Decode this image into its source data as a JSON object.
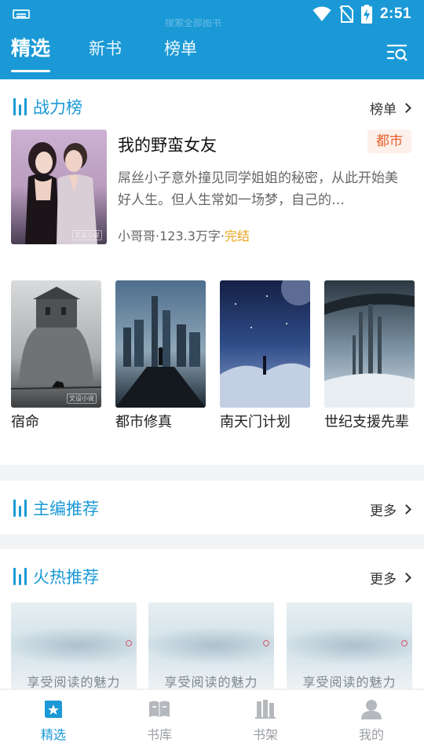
{
  "status_bar": {
    "time": "2:51",
    "overlay_text": "搜索全部图书"
  },
  "header": {
    "tabs": [
      {
        "label": "精选",
        "active": true
      },
      {
        "label": "新书",
        "active": false
      },
      {
        "label": "榜单",
        "active": false
      }
    ]
  },
  "ranking": {
    "title": "战力榜",
    "link_label": "榜单",
    "featured": {
      "title": "我的野蛮女友",
      "genre": "都市",
      "description": "屌丝小子意外撞见同学姐姐的秘密，从此开始美好人生。但人生常如一场梦，自己的…",
      "author": "小哥哥",
      "word_count": "123.3万字",
      "status": "完结",
      "separator": "·"
    },
    "books": [
      {
        "title": "宿命"
      },
      {
        "title": "都市修真"
      },
      {
        "title": "南天门计划"
      },
      {
        "title": "世纪支援先辈"
      }
    ],
    "cover_watermark": "文设小说"
  },
  "editor_picks": {
    "title": "主编推荐",
    "more_label": "更多"
  },
  "hot": {
    "title": "火热推荐",
    "more_label": "更多",
    "tiles": [
      {
        "caption": "享受阅读的魅力"
      },
      {
        "caption": "享受阅读的魅力"
      },
      {
        "caption": "享受阅读的魅力"
      }
    ]
  },
  "bottom_nav": {
    "items": [
      {
        "label": "精选",
        "icon": "star-book-icon",
        "active": true
      },
      {
        "label": "书库",
        "icon": "open-book-icon",
        "active": false
      },
      {
        "label": "书架",
        "icon": "bookshelf-icon",
        "active": false
      },
      {
        "label": "我的",
        "icon": "person-icon",
        "active": false
      }
    ]
  },
  "colors": {
    "brand": "#1a99d6",
    "genre_tag": "#e8612d",
    "status_done": "#e8a319"
  }
}
